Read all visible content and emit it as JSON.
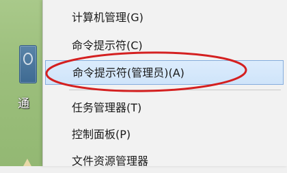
{
  "desktop": {
    "label": "通",
    "icon": "desktop-shortcut-icon"
  },
  "menu": {
    "items": [
      {
        "label": "计算机管理(G)"
      },
      {
        "label": "命令提示符(C)"
      },
      {
        "label": "命令提示符(管理员)(A)",
        "highlighted": true
      },
      {
        "label": "任务管理器(T)"
      },
      {
        "label": "控制面板(P)"
      },
      {
        "label": "文件资源管理器"
      }
    ]
  },
  "colors": {
    "highlight_bg": "#cfe4fa",
    "highlight_border": "#84acdd",
    "annotation": "#d42020"
  }
}
